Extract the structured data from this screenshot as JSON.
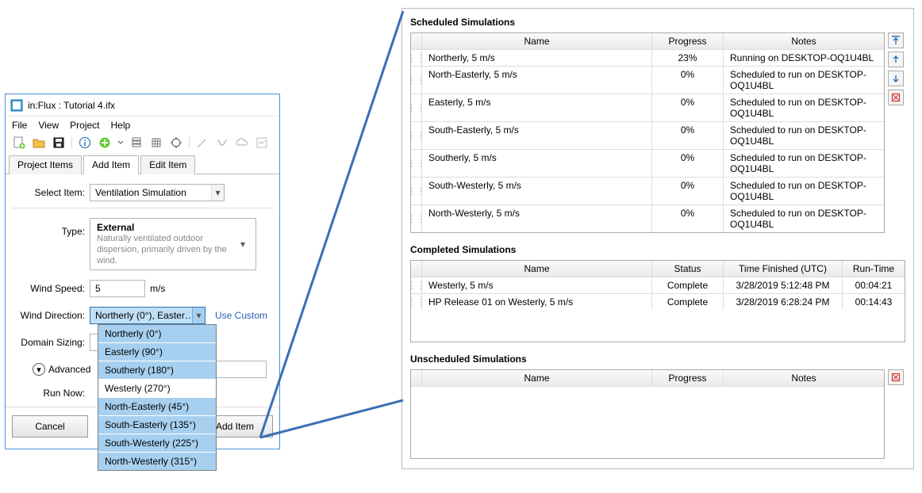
{
  "window": {
    "title": "in:Flux : Tutorial 4.ifx",
    "menu": {
      "file": "File",
      "view": "View",
      "project": "Project",
      "help": "Help"
    },
    "tabs": {
      "items": [
        "Project Items",
        "Add Item",
        "Edit Item"
      ],
      "activeIndex": 1
    },
    "form": {
      "select_item_label": "Select Item:",
      "select_item_value": "Ventilation Simulation",
      "type_label": "Type:",
      "type_title": "External",
      "type_desc": "Naturally ventilated outdoor dispersion, primarily driven by the wind.",
      "wind_speed_label": "Wind Speed:",
      "wind_speed_value": "5",
      "wind_speed_unit": "m/s",
      "wind_dir_label": "Wind Direction:",
      "wind_dir_value": "Northerly (0°), Easter…",
      "use_custom": "Use Custom",
      "domain_label": "Domain Sizing:",
      "advanced": "Advanced",
      "run_now_label": "Run Now:",
      "cancel": "Cancel",
      "add_item": "Add Item"
    },
    "dropdown": [
      {
        "label": "Northerly (0°)",
        "hl": true
      },
      {
        "label": "Easterly (90°)",
        "hl": true
      },
      {
        "label": "Southerly (180°)",
        "hl": true
      },
      {
        "label": "Westerly (270°)",
        "hl": false
      },
      {
        "label": "North-Easterly (45°)",
        "hl": true
      },
      {
        "label": "South-Easterly (135°)",
        "hl": true
      },
      {
        "label": "South-Westerly (225°)",
        "hl": true
      },
      {
        "label": "North-Westerly (315°)",
        "hl": true
      }
    ]
  },
  "scheduled": {
    "title": "Scheduled Simulations",
    "headers": {
      "name": "Name",
      "progress": "Progress",
      "notes": "Notes"
    },
    "rows": [
      {
        "name": "Northerly, 5 m/s",
        "progress": "23%",
        "notes": "Running on DESKTOP-OQ1U4BL"
      },
      {
        "name": "North-Easterly, 5 m/s",
        "progress": "0%",
        "notes": "Scheduled to run on DESKTOP-OQ1U4BL"
      },
      {
        "name": "Easterly, 5 m/s",
        "progress": "0%",
        "notes": "Scheduled to run on DESKTOP-OQ1U4BL"
      },
      {
        "name": "South-Easterly, 5 m/s",
        "progress": "0%",
        "notes": "Scheduled to run on DESKTOP-OQ1U4BL"
      },
      {
        "name": "Southerly, 5 m/s",
        "progress": "0%",
        "notes": "Scheduled to run on DESKTOP-OQ1U4BL"
      },
      {
        "name": "South-Westerly, 5 m/s",
        "progress": "0%",
        "notes": "Scheduled to run on DESKTOP-OQ1U4BL"
      },
      {
        "name": "North-Westerly, 5 m/s",
        "progress": "0%",
        "notes": "Scheduled to run on DESKTOP-OQ1U4BL"
      }
    ]
  },
  "completed": {
    "title": "Completed Simulations",
    "headers": {
      "name": "Name",
      "status": "Status",
      "time": "Time Finished (UTC)",
      "run": "Run-Time"
    },
    "rows": [
      {
        "name": "Westerly, 5 m/s",
        "status": "Complete",
        "time": "3/28/2019 5:12:48 PM",
        "run": "00:04:21"
      },
      {
        "name": "HP Release 01 on Westerly, 5 m/s",
        "status": "Complete",
        "time": "3/28/2019 6:28:24 PM",
        "run": "00:14:43"
      }
    ]
  },
  "unscheduled": {
    "title": "Unscheduled Simulations",
    "headers": {
      "name": "Name",
      "progress": "Progress",
      "notes": "Notes"
    }
  }
}
